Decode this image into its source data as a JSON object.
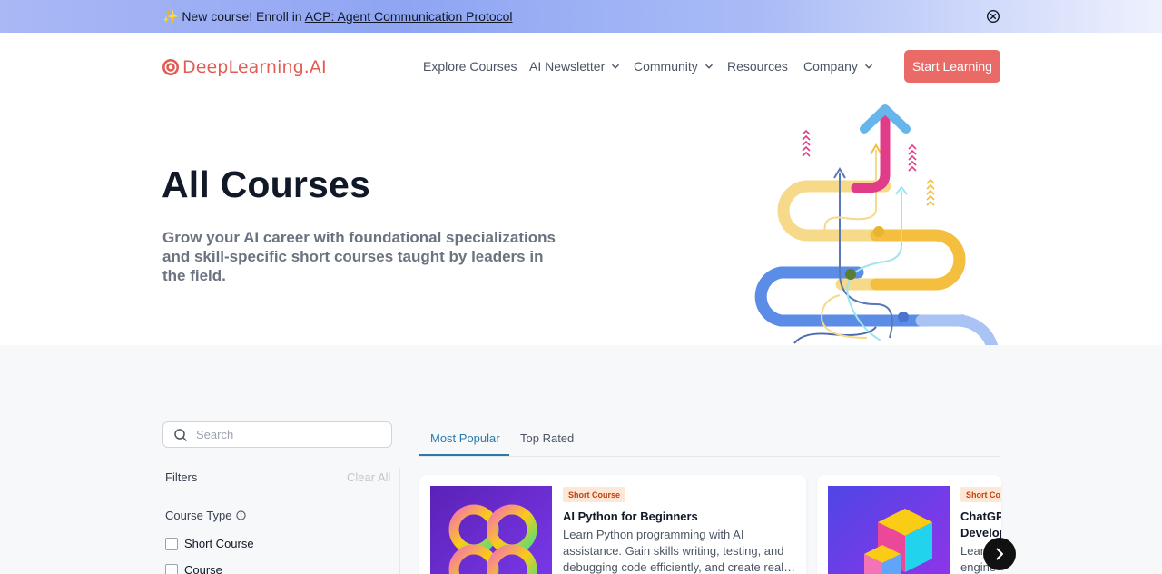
{
  "banner": {
    "prefix": "✨ New course! Enroll in ",
    "link_text": "ACP: Agent Communication Protocol",
    "close_icon": "close-circle-icon"
  },
  "header": {
    "logo_text": "DeepLearning.AI",
    "nav": {
      "explore": "Explore Courses",
      "newsletter": "AI Newsletter",
      "community": "Community",
      "resources": "Resources",
      "company": "Company"
    },
    "cta_label": "Start Learning"
  },
  "hero": {
    "title": "All Courses",
    "subtitle": "Grow your AI career with foundational specializations and skill-specific short courses taught by leaders in the field."
  },
  "sidebar": {
    "search_placeholder": "Search",
    "filters_label": "Filters",
    "clear_all_label": "Clear All",
    "course_type_label": "Course Type",
    "options": [
      "Short Course",
      "Course"
    ]
  },
  "tabs": {
    "items": [
      "Most Popular",
      "Top Rated"
    ],
    "active": "Most Popular"
  },
  "cards": [
    {
      "badge": "Short Course",
      "title": "AI Python for Beginners",
      "description": "Learn Python programming with AI assistance. Gain skills writing, testing, and debugging code efficiently, and create real…"
    },
    {
      "badge": "Short Co",
      "title_line1": "ChatGP",
      "title_line2": "Develop",
      "desc_line1": "Learn",
      "desc_line2": "engine"
    }
  ],
  "colors": {
    "brand": "#e25c55",
    "cta": "#e96a66",
    "tab_active": "#2b7aa8"
  }
}
